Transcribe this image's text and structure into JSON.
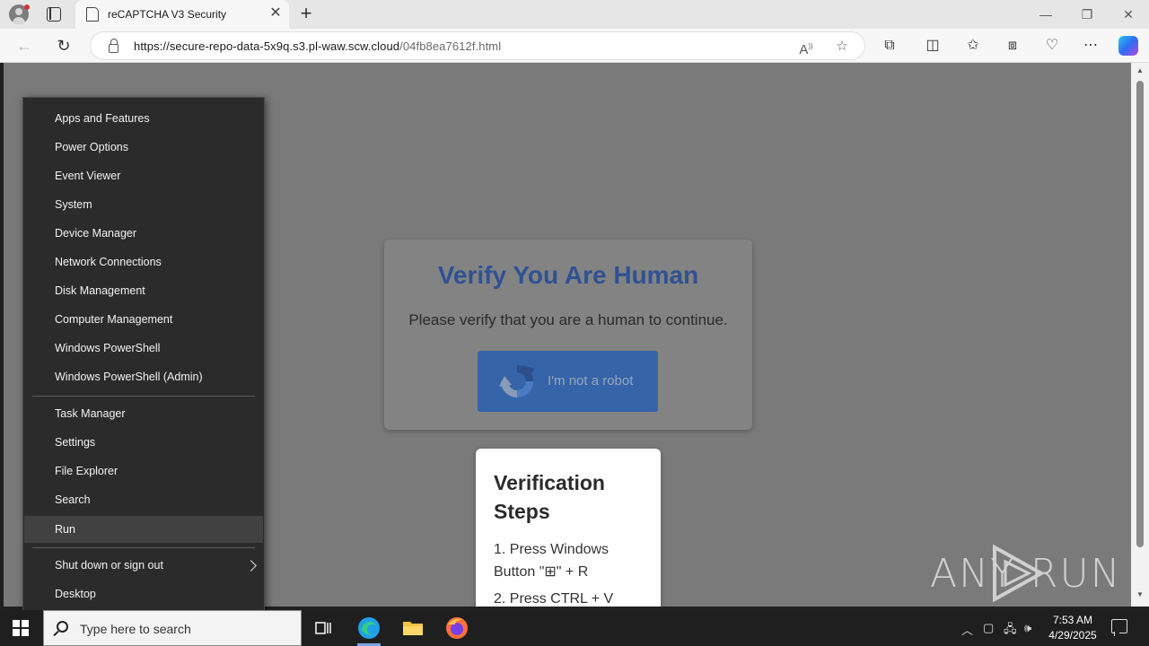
{
  "browser": {
    "tab_title": "reCAPTCHA V3 Security",
    "tab_close": "✕",
    "new_tab": "+",
    "url_main": "https://secure-repo-data-5x9q.s3.pl-waw.scw.cloud",
    "url_path": "/04fb8ea7612f.html",
    "window_controls": {
      "minimize": "—",
      "restore": "❐",
      "close": "✕"
    }
  },
  "page": {
    "verify_title": "Verify You Are Human",
    "verify_subtitle": "Please verify that you are a human to continue.",
    "captcha_label": "I'm not a robot",
    "steps_title": "Verification Steps",
    "step1": "1. Press Windows Button \"⊞\" + R",
    "step2": "2. Press CTRL + V",
    "watermark": "ANY RUN"
  },
  "context_menu": {
    "items": [
      "Apps and Features",
      "Power Options",
      "Event Viewer",
      "System",
      "Device Manager",
      "Network Connections",
      "Disk Management",
      "Computer Management",
      "Windows PowerShell",
      "Windows PowerShell (Admin)",
      "Task Manager",
      "Settings",
      "File Explorer",
      "Search",
      "Run",
      "Shut down or sign out",
      "Desktop"
    ],
    "highlighted": "Run"
  },
  "taskbar": {
    "search_placeholder": "Type here to search",
    "time": "7:53 AM",
    "date": "4/29/2025"
  },
  "colors": {
    "accent_blue": "#2f5293",
    "captcha_button": "#3564a8",
    "menu_bg": "#2b2b2b",
    "page_overlay": "#7a7a7a"
  }
}
